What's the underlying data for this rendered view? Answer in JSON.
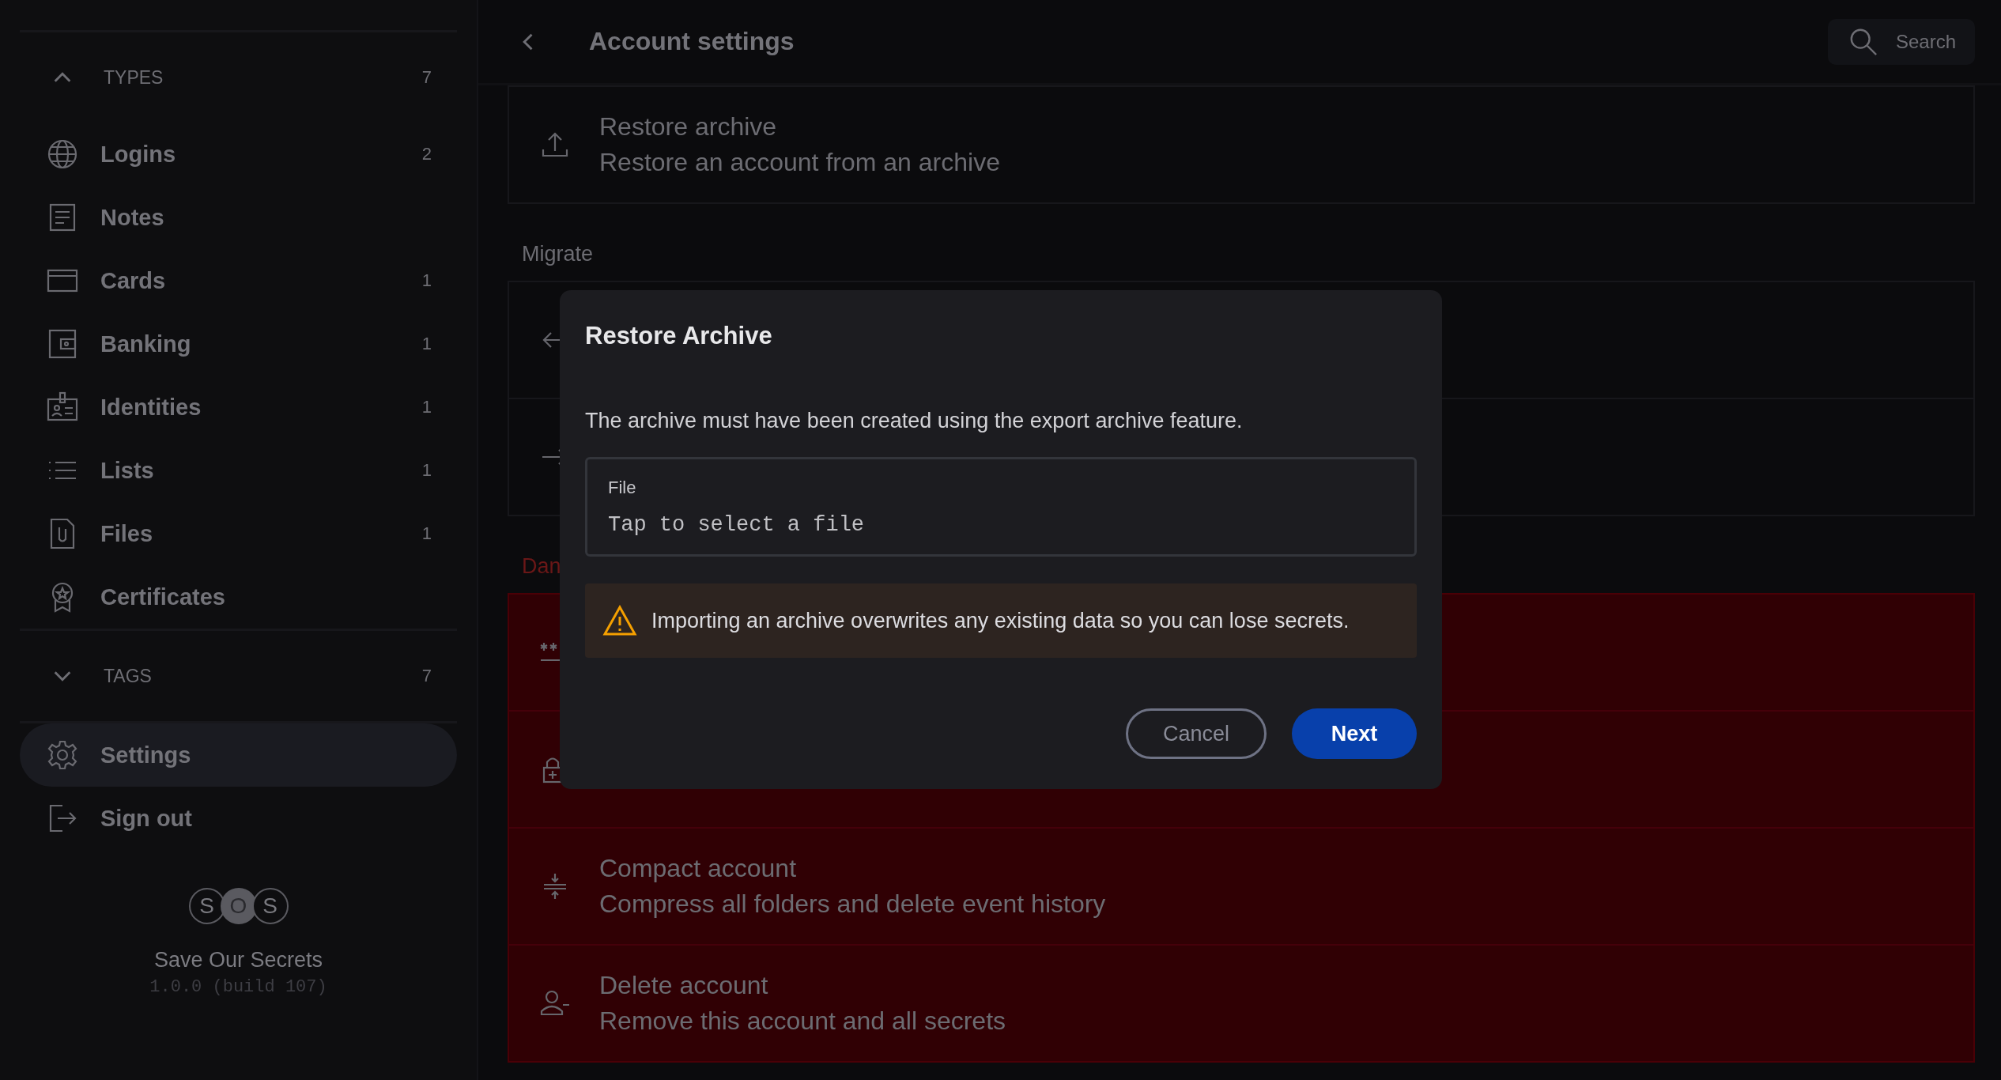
{
  "sidebar": {
    "groups": [
      {
        "label": "TYPES",
        "count": "7",
        "expanded": true,
        "items": [
          {
            "label": "Logins",
            "count": "2"
          },
          {
            "label": "Notes"
          },
          {
            "label": "Cards",
            "count": "1"
          },
          {
            "label": "Banking",
            "count": "1"
          },
          {
            "label": "Identities",
            "count": "1"
          },
          {
            "label": "Lists",
            "count": "1"
          },
          {
            "label": "Files",
            "count": "1"
          },
          {
            "label": "Certificates"
          }
        ]
      },
      {
        "label": "TAGS",
        "count": "7",
        "expanded": false
      }
    ],
    "nav": [
      {
        "label": "Settings",
        "selected": true
      },
      {
        "label": "Sign out",
        "selected": false
      }
    ],
    "logo": [
      "S",
      "O",
      "S"
    ],
    "app_name": "Save Our Secrets",
    "version": "1.0.0 (build 107)"
  },
  "header": {
    "title": "Account settings",
    "search": "Search"
  },
  "sections": [
    {
      "kind": "normal",
      "rows": [
        {
          "kind": "upload",
          "title": "Restore archive",
          "subtitle": "Restore an account from an archive"
        }
      ]
    },
    {
      "kind": "normal",
      "label": "Migrate",
      "rows": [
        {
          "kind": "import"
        },
        {
          "kind": "export"
        }
      ]
    },
    {
      "kind": "danger",
      "label": "Dan",
      "rows": [
        {
          "kind": "password"
        },
        {
          "kind": "cipher"
        },
        {
          "kind": "compact",
          "title": "Compact account",
          "subtitle": "Compress all folders and delete event history"
        },
        {
          "kind": "delete",
          "title": "Delete account",
          "subtitle": "Remove this account and all secrets"
        }
      ]
    }
  ],
  "dialog": {
    "title": "Restore Archive",
    "description": "The archive must have been created using the export archive feature.",
    "field": {
      "label": "File",
      "placeholder": "Tap to select a file"
    },
    "warning": "Importing an archive overwrites any existing data so you can lose secrets.",
    "buttons": [
      {
        "label": "Cancel",
        "kind": "secondary"
      },
      {
        "label": "Next",
        "kind": "primary"
      }
    ]
  }
}
